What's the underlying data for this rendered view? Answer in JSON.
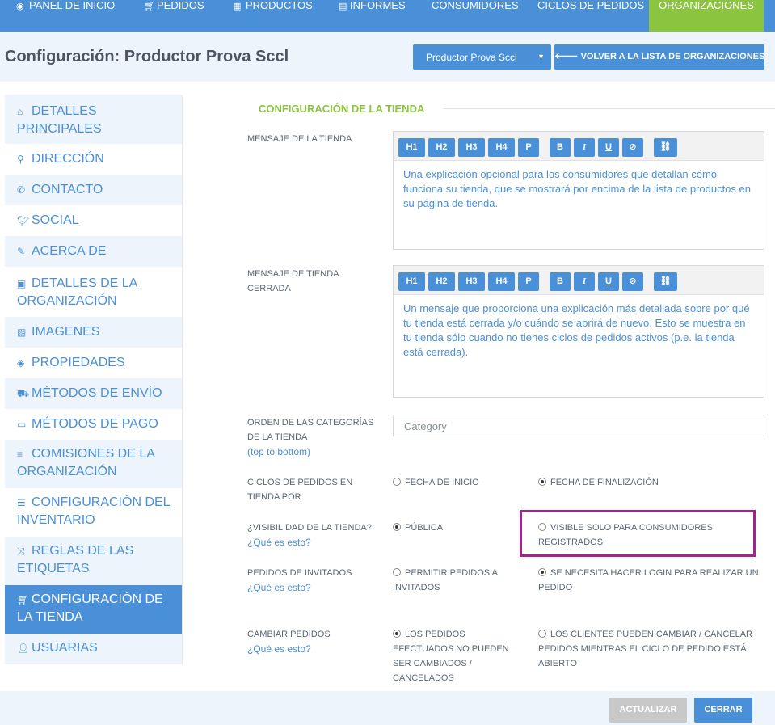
{
  "nav": {
    "items": [
      {
        "icon": "dashboard-icon",
        "label": "PANEL DE INICIO"
      },
      {
        "icon": "cart-icon",
        "label": "PEDIDOS"
      },
      {
        "icon": "grid-icon",
        "label": "PRODUCTOS"
      },
      {
        "icon": "document-icon",
        "label": "INFORMES"
      },
      {
        "icon": "",
        "label": "CONSUMIDORES"
      },
      {
        "icon": "",
        "label": "CICLOS DE PEDIDOS"
      },
      {
        "icon": "",
        "label": "ORGANIZACIONES"
      }
    ],
    "active": "ORGANIZACIONES"
  },
  "header": {
    "title": "Configuración: Productor Prova Sccl",
    "org_select": "Productor Prova Sccl",
    "back_button": "VOLVER A LA LISTA DE ORGANIZACIONES"
  },
  "sidebar": {
    "items": [
      {
        "icon": "home-icon",
        "label": "DETALLES PRINCIPALES"
      },
      {
        "icon": "map-marker-icon",
        "label": "DIRECCIÓN"
      },
      {
        "icon": "phone-icon",
        "label": "CONTACTO"
      },
      {
        "icon": "twitter-icon",
        "label": "SOCIAL"
      },
      {
        "icon": "pencil-icon",
        "label": "ACERCA DE"
      },
      {
        "icon": "briefcase-icon",
        "label": "DETALLES DE LA ORGANIZACIÓN"
      },
      {
        "icon": "image-icon",
        "label": "IMAGENES"
      },
      {
        "icon": "tags-icon",
        "label": "PROPIEDADES"
      },
      {
        "icon": "truck-icon",
        "label": "MÉTODOS DE ENVÍO"
      },
      {
        "icon": "money-icon",
        "label": "MÉTODOS DE PAGO"
      },
      {
        "icon": "list-icon",
        "label": "COMISIONES DE LA ORGANIZACIÓN"
      },
      {
        "icon": "list-ul-icon",
        "label": "CONFIGURACIÓN DEL INVENTARIO"
      },
      {
        "icon": "shuffle-icon",
        "label": "REGLAS DE LAS ETIQUETAS"
      },
      {
        "icon": "cart-icon",
        "label": "CONFIGURACIÓN DE LA TIENDA"
      },
      {
        "icon": "user-icon",
        "label": "USUARIAS"
      }
    ],
    "active": "CONFIGURACIÓN DE LA TIENDA"
  },
  "main": {
    "section_title": "CONFIGURACIÓN DE LA TIENDA",
    "toolbar": [
      "H1",
      "H2",
      "H3",
      "H4",
      "P",
      "B",
      "I",
      "U",
      "⊘",
      "🔗"
    ],
    "shop_message": {
      "label": "MENSAJE DE LA TIENDA",
      "text": "Una explicación opcional para los consumidores que detallan cómo funciona su tienda, que se mostrará por encima de la lista de productos en su página de tienda."
    },
    "closed_message": {
      "label": "MENSAJE DE TIENDA CERRADA",
      "text": "Un mensaje que proporciona una explicación más detallada sobre por qué tu tienda está cerrada y/o cuándo se abrirá de nuevo. Esto se muestra en tu tienda sólo cuando no tienes ciclos de pedidos activos (p.e. la tienda está cerrada)."
    },
    "category_order": {
      "label": "ORDEN DE LAS CATEGORÍAS DE LA TIENDA",
      "help": "(top to bottom)",
      "placeholder": "Category"
    },
    "order_cycles": {
      "label": "CICLOS DE PEDIDOS EN TIENDA POR",
      "options": [
        "FECHA DE INICIO",
        "FECHA DE FINALIZACIÓN"
      ],
      "selected": 1
    },
    "visibility": {
      "label": "¿VISIBILIDAD DE LA TIENDA?",
      "help": "¿Qué es esto?",
      "options": [
        "PÚBLICA",
        "VISIBLE SOLO PARA CONSUMIDORES REGISTRADOS"
      ],
      "selected": 0
    },
    "guest_orders": {
      "label": "PEDIDOS DE INVITADOS",
      "help": "¿Qué es esto?",
      "options": [
        "PERMITIR PEDIDOS A INVITADOS",
        "SE NECESITA HACER LOGIN PARA REALIZAR UN PEDIDO"
      ],
      "selected": 1
    },
    "change_orders": {
      "label": "CAMBIAR PEDIDOS",
      "help": "¿Qué es esto?",
      "options": [
        "LOS PEDIDOS EFECTUADOS NO PUEDEN SER CAMBIADOS / CANCELADOS",
        "LOS CLIENTES PUEDEN CAMBIAR / CANCELAR PEDIDOS MIENTRAS EL CICLO DE PEDIDO ESTÁ ABIERTO"
      ],
      "selected": 0
    }
  },
  "footer": {
    "update": "ACTUALIZAR",
    "close": "CERRAR"
  },
  "colors": {
    "primary": "#4a90d9",
    "accent": "#8bc53f",
    "highlight": "#a3238e",
    "disabled": "#c8c8c8"
  }
}
